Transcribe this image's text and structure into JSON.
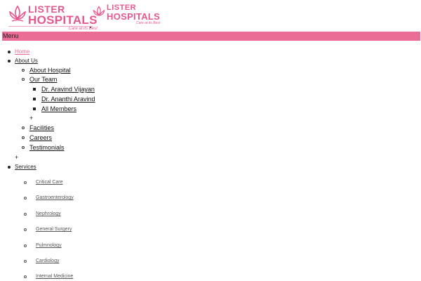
{
  "header": {
    "logo1": {
      "word1": "LISTER",
      "word2": "HOSPITALS",
      "tagline": "Care at its Best"
    },
    "logo2": {
      "word1": "LISTER",
      "word2": "HOSPITALS",
      "tagline": "Care at its Best"
    }
  },
  "menu_label": "Menu",
  "nav": {
    "home": "Home",
    "about_us": "About Us",
    "about_children": {
      "about_hospital": "About Hospital",
      "our_team": "Our Team",
      "team_members": [
        "Dr. Aravind Vijayan",
        "Dr. Ananthi Aravind",
        "All Members"
      ],
      "team_expand": "+",
      "facilities": "Facilities",
      "careers": "Careers",
      "testimonials": "Testimonials"
    },
    "about_expand": "+",
    "services": "Services",
    "services_children": [
      "Critical Care",
      "Gastroenterology",
      "Nephrology",
      "General Surgery",
      "Pulmnology",
      "Cardiology",
      "Internal Medicine"
    ]
  },
  "colors": {
    "accent": "#e96d95",
    "logo": "#e7578f"
  }
}
